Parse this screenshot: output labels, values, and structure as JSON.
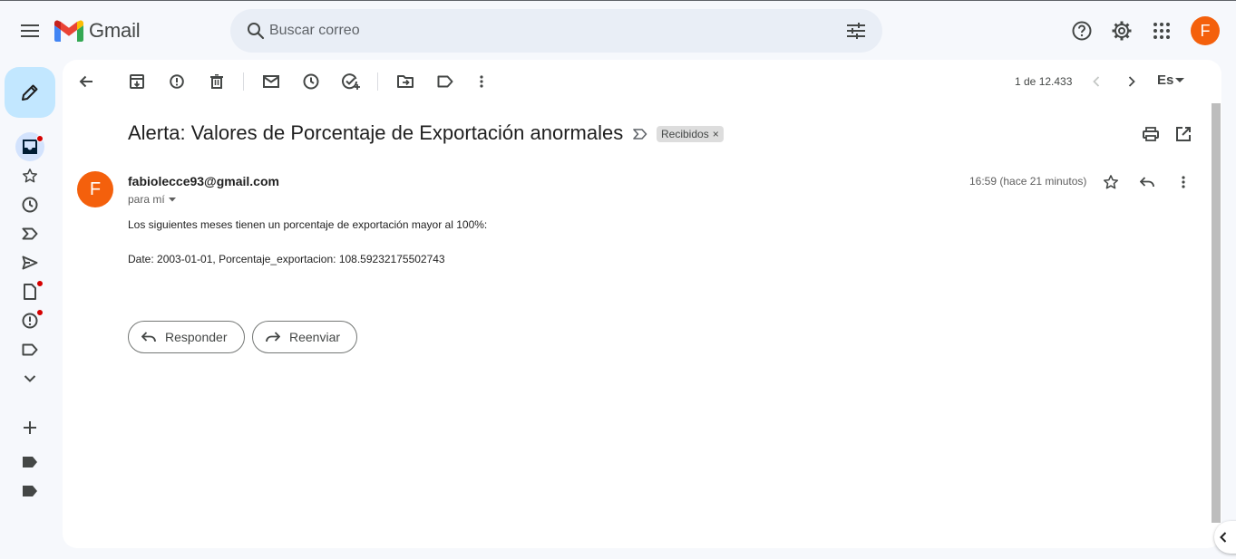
{
  "app": {
    "name": "Gmail",
    "colors": {
      "accent": "#0b57d0",
      "avatar_bg": "#f4600c",
      "compose_bg": "#c2e7ff",
      "badge": "#d50000"
    }
  },
  "header": {
    "search_placeholder": "Buscar correo",
    "avatar_letter": "F",
    "icons": [
      "menu-icon",
      "search-icon",
      "tune-icon",
      "help-icon",
      "settings-icon",
      "apps-icon"
    ]
  },
  "rail": {
    "items": [
      {
        "name": "inbox",
        "icon": "inbox-icon",
        "badge": true,
        "active": true
      },
      {
        "name": "starred",
        "icon": "star-icon",
        "badge": false
      },
      {
        "name": "snoozed",
        "icon": "clock-icon",
        "badge": false
      },
      {
        "name": "important",
        "icon": "important-icon",
        "badge": false
      },
      {
        "name": "sent",
        "icon": "send-icon",
        "badge": false
      },
      {
        "name": "drafts",
        "icon": "draft-icon",
        "badge": true
      },
      {
        "name": "spam",
        "icon": "spam-icon",
        "badge": true
      },
      {
        "name": "labels",
        "icon": "label-icon",
        "badge": false
      },
      {
        "name": "more",
        "icon": "chevron-down-icon",
        "badge": false
      }
    ]
  },
  "toolbar": {
    "pager": "1 de 12.433",
    "lang": "Es"
  },
  "email": {
    "subject": "Alerta: Valores de Porcentaje de Exportación anormales",
    "label": "Recibidos",
    "label_close": "×",
    "sender": "fabiolecce93@gmail.com",
    "sender_initial": "F",
    "recipient": "para mí",
    "timestamp": "16:59 (hace 21 minutos)",
    "body_line1": "Los siguientes meses tienen un porcentaje de exportación mayor al 100%:",
    "body_line2": "Date: 2003-01-01, Porcentaje_exportacion: 108.59232175502743",
    "reply_label": "Responder",
    "forward_label": "Reenviar"
  }
}
